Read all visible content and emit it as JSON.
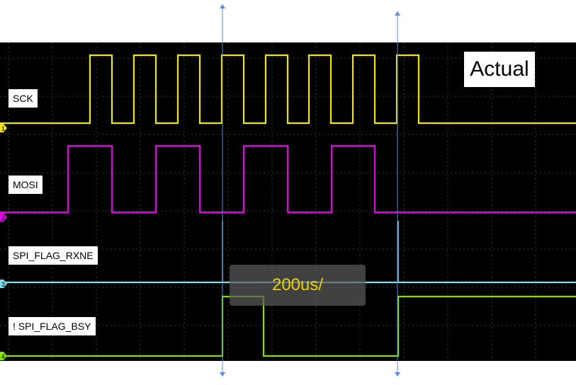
{
  "title": "Actual",
  "timebase": "200us/",
  "channels": [
    {
      "label": "SCK",
      "marker": "1",
      "color": "#f2e600"
    },
    {
      "label": "MOSI",
      "marker": "2",
      "color": "#e600e6"
    },
    {
      "label": "SPI_FLAG_RXNE",
      "marker": "3",
      "color": "#80e0f0"
    },
    {
      "label": "! SPI_FLAG_BSY",
      "marker": "4",
      "color": "#88e000"
    }
  ]
}
